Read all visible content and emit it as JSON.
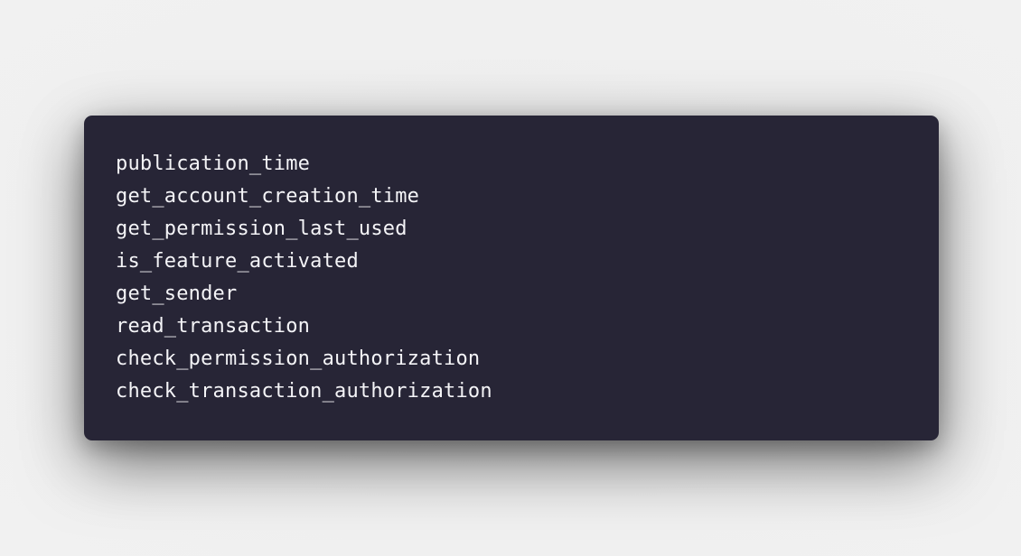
{
  "code_block": {
    "lines": [
      "publication_time",
      "get_account_creation_time",
      "get_permission_last_used",
      "is_feature_activated",
      "get_sender",
      "read_transaction",
      "check_permission_authorization",
      "check_transaction_authorization"
    ]
  },
  "colors": {
    "page_background": "#efefef",
    "card_background": "#272536",
    "code_text": "#f4f4f7"
  }
}
